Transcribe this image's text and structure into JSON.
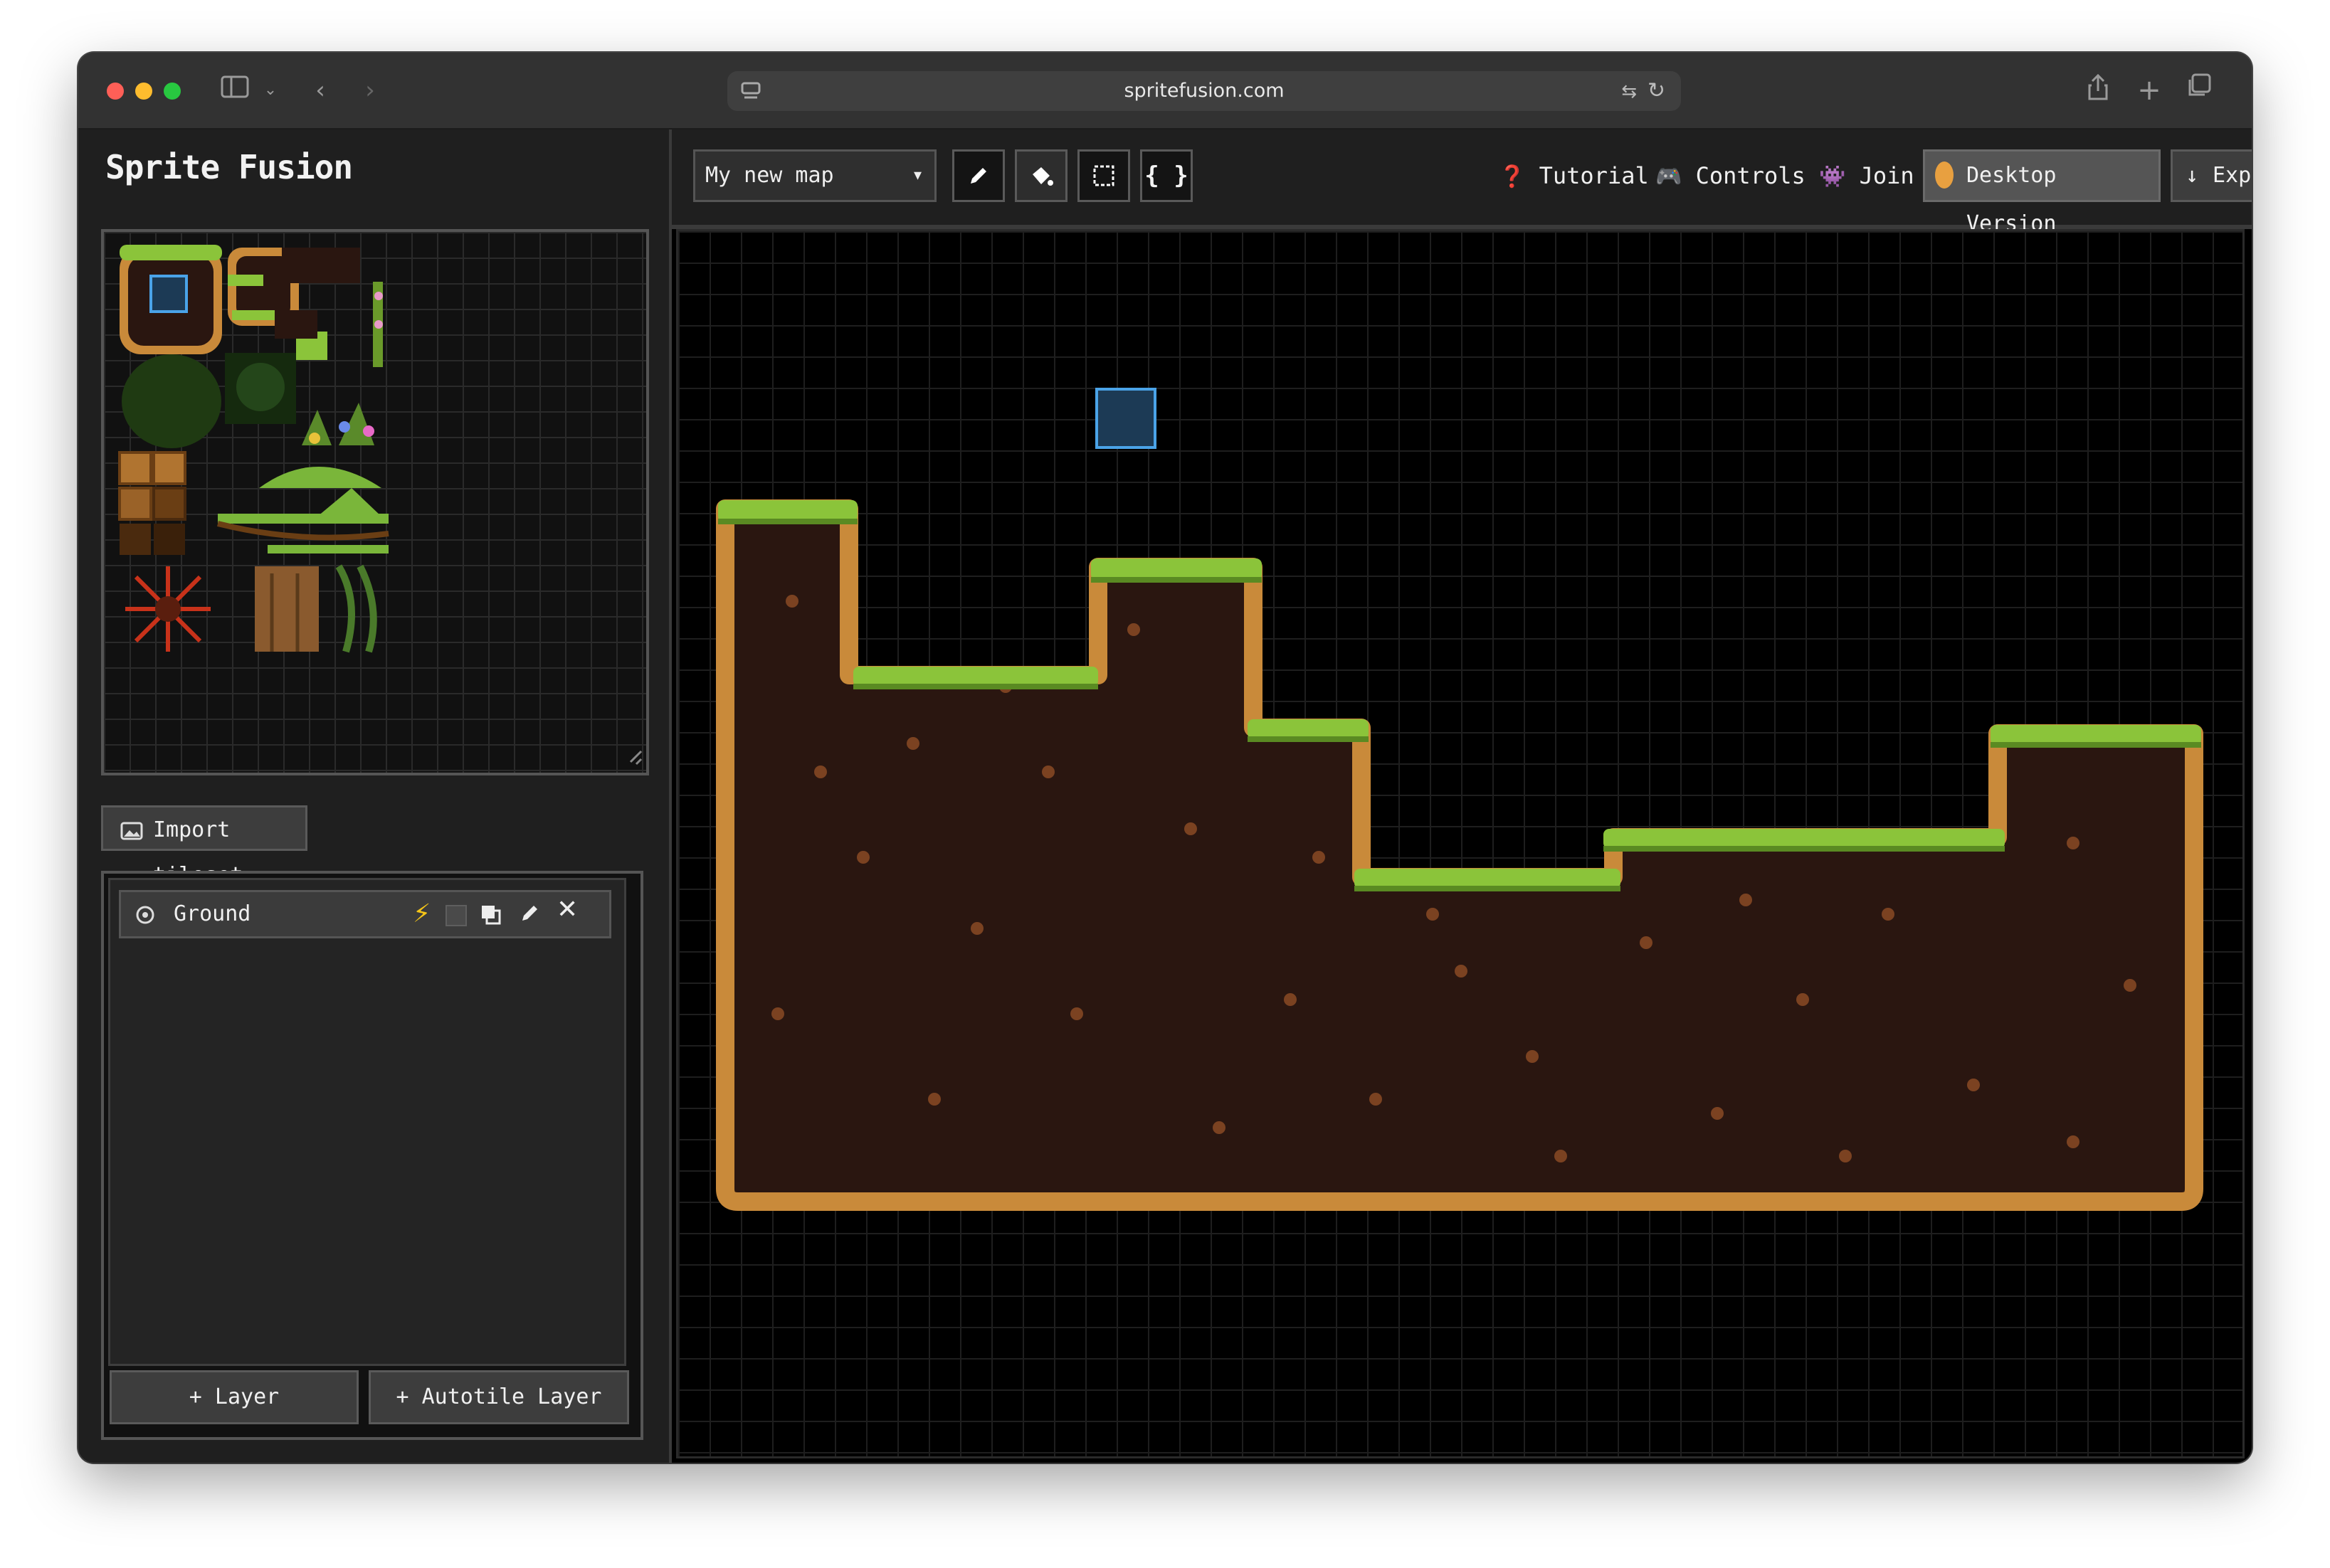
{
  "browser": {
    "url": "spritefusion.com",
    "traffic_lights": {
      "close": "#ff5f57",
      "minimize": "#febc2e",
      "zoom": "#28c840"
    }
  },
  "sidebar": {
    "app_title": "Sprite Fusion",
    "import_label": "Import tileset",
    "layers": [
      {
        "name": "Ground"
      }
    ],
    "add_layer_label": "+ Layer",
    "add_autotile_label": "+ Autotile Layer"
  },
  "toolbar": {
    "map_select_value": "My new map",
    "tools": [
      "pencil-icon",
      "bucket-icon",
      "select-icon",
      "braces-icon"
    ],
    "links": {
      "tutorial": "Tutorial",
      "controls": "Controls",
      "join": "Join",
      "desktop": "Desktop Version",
      "export": "Export"
    }
  },
  "colors": {
    "accent": "#4aa3e8",
    "grass": "#8bc43a",
    "dirt": "#2a1610",
    "dirt_border": "#c98a3a"
  }
}
